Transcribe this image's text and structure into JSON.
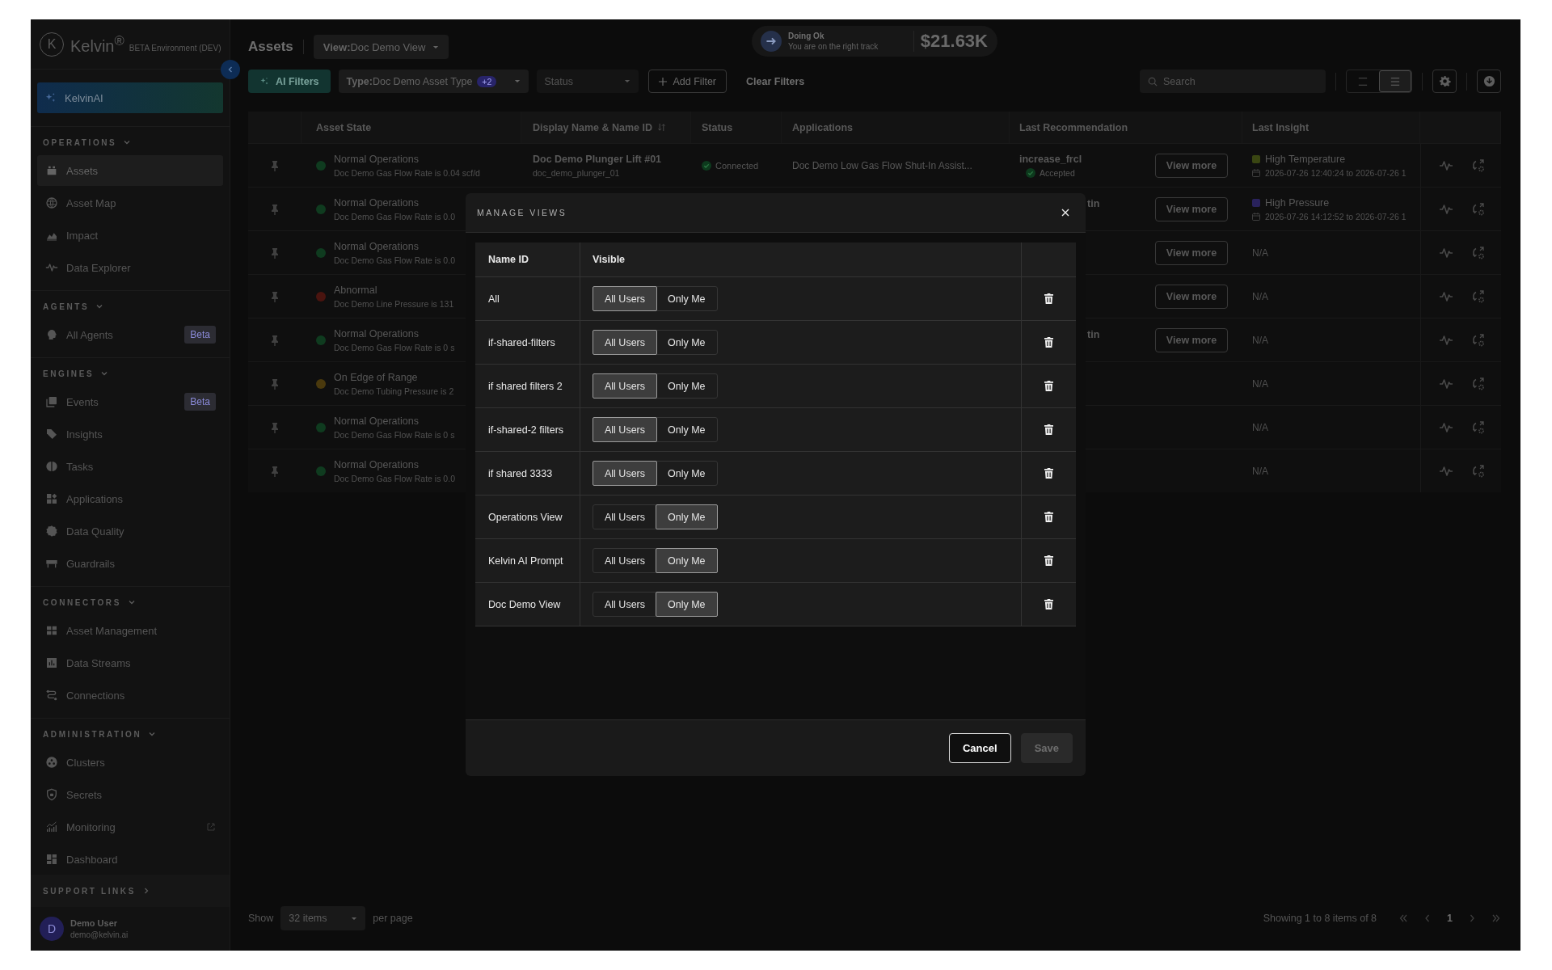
{
  "sidebar": {
    "logo": {
      "mark": "K",
      "name": "Kelvin$^{®}$",
      "environment": "BETA Environment (DEV)"
    },
    "kelvin_ai": {
      "label": "KelvinAI"
    },
    "sections": [
      {
        "title": "OPERATIONS",
        "expanded": true,
        "items": [
          {
            "label": "Assets",
            "selected": true,
            "external": false
          },
          {
            "label": "Asset Map",
            "selected": false,
            "external": false
          },
          {
            "label": "Impact",
            "selected": false,
            "external": false
          },
          {
            "label": "Data Explorer",
            "selected": false,
            "external": false
          }
        ]
      },
      {
        "title": "AGENTS",
        "expanded": true,
        "items": [
          {
            "label": "All Agents",
            "selected": false,
            "external": false,
            "badge": "Beta"
          }
        ]
      },
      {
        "title": "ENGINES",
        "expanded": true,
        "items": [
          {
            "label": "Events",
            "selected": false,
            "external": false,
            "badge": "Beta"
          },
          {
            "label": "Insights",
            "selected": false,
            "external": false
          },
          {
            "label": "Tasks",
            "selected": false,
            "external": false
          },
          {
            "label": "Applications",
            "selected": false,
            "external": false
          },
          {
            "label": "Data Quality",
            "selected": false,
            "external": false
          },
          {
            "label": "Guardrails",
            "selected": false,
            "external": false
          }
        ]
      },
      {
        "title": "CONNECTORS",
        "expanded": true,
        "items": [
          {
            "label": "Asset Management",
            "selected": false,
            "external": false
          },
          {
            "label": "Data Streams",
            "selected": false,
            "external": false
          },
          {
            "label": "Connections",
            "selected": false,
            "external": false
          }
        ]
      },
      {
        "title": "ADMINISTRATION",
        "expanded": true,
        "items": [
          {
            "label": "Clusters",
            "selected": false,
            "external": false
          },
          {
            "label": "Secrets",
            "selected": false,
            "external": false
          },
          {
            "label": "Monitoring",
            "selected": false,
            "external": true
          },
          {
            "label": "Dashboard",
            "selected": false,
            "external": false
          }
        ]
      }
    ],
    "support_links": {
      "title": "SUPPORT LINKS",
      "expanded": false
    },
    "user": {
      "initial": "D",
      "name": "Demo User",
      "email": "demo@kelvin.ai"
    }
  },
  "header": {
    "title": "Assets",
    "view": "**View:**Doc Demo View",
    "status": {
      "title": "Doing Ok",
      "message": "You are on the right track",
      "amount": "$21.63K"
    }
  },
  "filters": {
    "ai_filters": "AI Filters",
    "type_filter": {
      "label": "**Type:**Doc Demo Asset Type",
      "count": "+2"
    },
    "status_filter": {
      "placeholder": "Status",
      "disabled": true
    },
    "add_filter": "Add Filter",
    "clear": "Clear Filters",
    "search": {
      "placeholder": "Search"
    },
    "layout_buttons": [
      {
        "selected": false
      },
      {
        "selected": true
      }
    ]
  },
  "table": {
    "columns": [
      {
        "label": "Asset State",
        "sortable": false
      },
      {
        "label": "Display Name & Name ID",
        "sortable": true
      },
      {
        "label": "Status",
        "sortable": false
      },
      {
        "label": "Applications",
        "sortable": false
      },
      {
        "label": "Last Recommendation",
        "sortable": false
      },
      {
        "label": "Last Insight",
        "sortable": false
      }
    ],
    "rows": [
      {
        "state": {
          "label": "Normal Operations",
          "color": "#0f3b1f",
          "detail": "Doc Demo Gas Flow Rate is 0.04 scf/d"
        },
        "display_name": "Doc Demo Plunger Lift #01",
        "name_id": "doc_demo_plunger_01",
        "status": "Connected",
        "application": "Doc Demo Low Gas Flow Shut-In Assist...",
        "last_recommendation": {
          "text": "increase_frcl",
          "status": "Accepted"
        },
        "view_more": "View more",
        "last_insight": {
          "kind": "event",
          "label": "High Temperature",
          "color": "#3a4612",
          "period": "2026-07-26 12:40:24 to 2026-07-26 1"
        }
      },
      {
        "state": {
          "label": "Normal Operations",
          "color": "#0f3b1f",
          "detail": "Doc Demo Gas Flow Rate is 0.0"
        },
        "last_recommendation": {
          "text": "tin"
        },
        "view_more": "View more",
        "last_insight": {
          "kind": "event",
          "label": "High Pressure",
          "color": "#29225c",
          "period": "2026-07-26 14:12:52 to 2026-07-26 1"
        }
      },
      {
        "state": {
          "label": "Normal Operations",
          "color": "#0f3b1f",
          "detail": "Doc Demo Gas Flow Rate is 0.0"
        },
        "view_more": "View more",
        "last_insight": {
          "kind": "none",
          "label": "N/A"
        }
      },
      {
        "state": {
          "label": "Abnormal",
          "color": "#4a140f",
          "detail": "Doc Demo Line Pressure is 131"
        },
        "view_more": "View more",
        "last_insight": {
          "kind": "none",
          "label": "N/A"
        }
      },
      {
        "state": {
          "label": "Normal Operations",
          "color": "#0f3b1f",
          "detail": "Doc Demo Gas Flow Rate is 0 s"
        },
        "last_recommendation": {
          "text": "tin"
        },
        "view_more": "View more",
        "last_insight": {
          "kind": "none",
          "label": "N/A"
        }
      },
      {
        "state": {
          "label": "On Edge of Range",
          "color": "#4a390d",
          "detail": "Doc Demo Tubing Pressure is 2"
        },
        "last_insight": {
          "kind": "none",
          "label": "N/A"
        }
      },
      {
        "state": {
          "label": "Normal Operations",
          "color": "#0f3b1f",
          "detail": "Doc Demo Gas Flow Rate is 0 s"
        },
        "last_insight": {
          "kind": "none",
          "label": "N/A"
        }
      },
      {
        "state": {
          "label": "Normal Operations",
          "color": "#0f3b1f",
          "detail": "Doc Demo Gas Flow Rate is 0.0"
        },
        "last_insight": {
          "kind": "none",
          "label": "N/A"
        }
      }
    ]
  },
  "footer": {
    "show": "Show",
    "page_size": "32 items",
    "per_page": "per page",
    "summary": "Showing 1 to 8 items of 8",
    "pages": [
      {
        "label": "1",
        "selected": true
      }
    ]
  },
  "dialog": {
    "title": "MANAGE VIEWS",
    "columns": [
      "Name ID",
      "Visible"
    ],
    "views": [
      {
        "name": "All",
        "options": [
          {
            "label": "All Users",
            "selected": true
          },
          {
            "label": "Only Me",
            "selected": false
          }
        ]
      },
      {
        "name": "if-shared-filters",
        "options": [
          {
            "label": "All Users",
            "selected": true
          },
          {
            "label": "Only Me",
            "selected": false
          }
        ]
      },
      {
        "name": "if shared filters 2",
        "options": [
          {
            "label": "All Users",
            "selected": true
          },
          {
            "label": "Only Me",
            "selected": false
          }
        ]
      },
      {
        "name": "if-shared-2 filters",
        "options": [
          {
            "label": "All Users",
            "selected": true
          },
          {
            "label": "Only Me",
            "selected": false
          }
        ]
      },
      {
        "name": "if shared 3333",
        "options": [
          {
            "label": "All Users",
            "selected": true
          },
          {
            "label": "Only Me",
            "selected": false
          }
        ]
      },
      {
        "name": "Operations View",
        "options": [
          {
            "label": "All Users",
            "selected": false
          },
          {
            "label": "Only Me",
            "selected": true
          }
        ]
      },
      {
        "name": "Kelvin AI Prompt",
        "options": [
          {
            "label": "All Users",
            "selected": false
          },
          {
            "label": "Only Me",
            "selected": true
          }
        ]
      },
      {
        "name": "Doc Demo View",
        "options": [
          {
            "label": "All Users",
            "selected": false
          },
          {
            "label": "Only Me",
            "selected": true
          }
        ]
      }
    ],
    "buttons": [
      {
        "label": "Cancel",
        "disabled": false
      },
      {
        "label": "Save",
        "disabled": true
      }
    ]
  }
}
